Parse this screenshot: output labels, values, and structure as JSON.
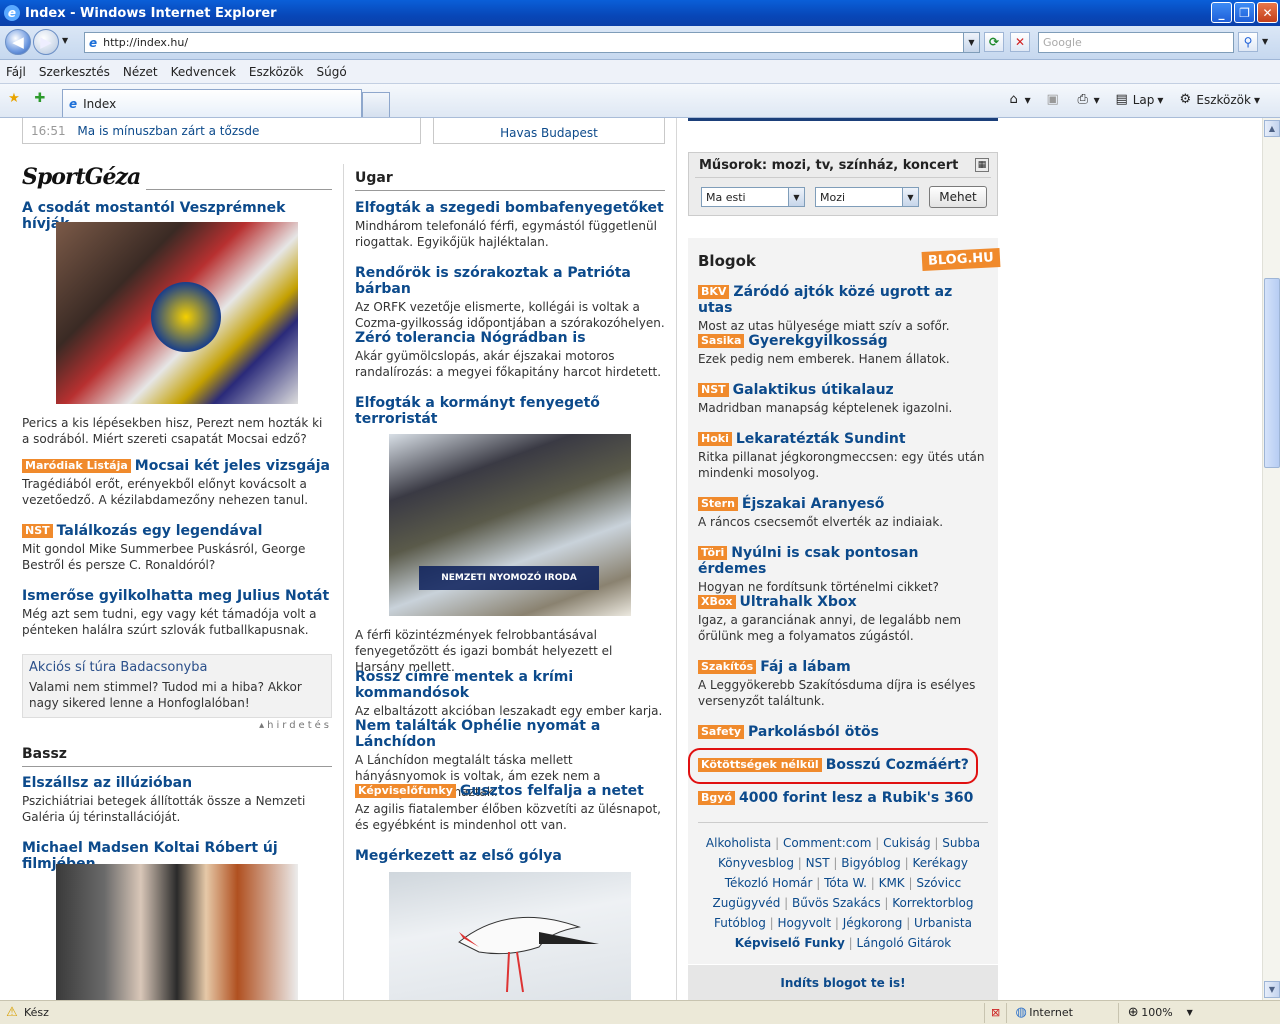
{
  "window": {
    "title": "Index - Windows Internet Explorer"
  },
  "address": {
    "url": "http://index.hu/",
    "search_placeholder": "Google"
  },
  "menu": [
    "Fájl",
    "Szerkesztés",
    "Nézet",
    "Kedvencek",
    "Eszközök",
    "Súgó"
  ],
  "tab": {
    "label": "Index"
  },
  "tools": {
    "page": "Lap",
    "tools": "Eszközök"
  },
  "status": {
    "text": "Kész",
    "zone": "Internet",
    "zoom": "100%"
  },
  "top": {
    "time": "16:51",
    "headline": "Ma is mínuszban zárt a tőzsde",
    "havas": "Havas Budapest"
  },
  "col1": {
    "logo": "SportGéza",
    "lead_title": "A csodát mostantól Veszprémnek hívják",
    "lead_desc": "Perics a kis lépésekben hisz, Perezt nem hozták ki a sodrából. Miért szereti csapatát Mocsai edző?",
    "items": [
      {
        "tag": "Maródiak Listája",
        "title": "Mocsai két jeles vizsgája",
        "desc": "Tragédiából erőt, erényekből előnyt kovácsolt a vezetőedző. A kézilabdamezőny nehezen tanul."
      },
      {
        "tag": "NST",
        "title": "Találkozás egy legendával",
        "desc": "Mit gondol Mike Summerbee Puskásról, George Bestről és persze C. Ronaldóról?"
      },
      {
        "tag": "",
        "title": "Ismerőse gyilkolhatta meg Julius Notát",
        "desc": "Még azt sem tudni, egy vagy két támadója volt a pénteken halálra szúrt szlovák futballkapusnak."
      }
    ],
    "ad_title": "Akciós sí túra Badacsonyba",
    "ad_text": "Valami nem stimmel? Tudod mi a hiba? Akkor nagy sikered lenne a Honfoglalóban!",
    "ad_label": "hirdetés",
    "section2": "Bassz",
    "items2": [
      {
        "title": "Elszállsz az illúzióban",
        "desc": "Pszichiátriai betegek állították össze a Nemzeti Galéria új térinstallációját."
      },
      {
        "title": "Michael Madsen Koltai Róbert új filmjében",
        "desc": ""
      }
    ]
  },
  "col2": {
    "section": "Ugar",
    "items": [
      {
        "tag": "",
        "title": "Elfogták a szegedi bombafenyegetőket",
        "desc": "Mindhárom telefonáló férfi, egymástól függetlenül riogattak. Egyikőjük hajléktalan."
      },
      {
        "tag": "",
        "title": "Rendőrök is szórakoztak a Patrióta bárban",
        "desc": "Az ORFK vezetője elismerte, kollégái is voltak a Cozma-gyilkosság időpontjában a szórakozóhelyen."
      },
      {
        "tag": "",
        "title": "Zéró tolerancia Nógrádban is",
        "desc": "Akár gyümölcslopás, akár éjszakai motoros randalírozás: a megyei főkapitány harcot hirdetett."
      },
      {
        "tag": "",
        "title": "Elfogták a kormányt fenyegető terroristát",
        "desc": ""
      }
    ],
    "photo_caption": "NEMZETI NYOMOZÓ IRODA",
    "photo_desc": "A férfi közintézmények felrobbantásával fenyegetőzött és igazi bombát helyezett el Harsány mellett.",
    "items2": [
      {
        "tag": "",
        "title": "Rossz címre mentek a krími kommandósok",
        "desc": "Az elbaltázott akcióban leszakadt egy ember karja."
      },
      {
        "tag": "",
        "title": "Nem találták Ophélie nyomát a Lánchídon",
        "desc": "A Lánchídon megtalált táska mellett hányásnyomok is voltak, ám ezek nem a diáklánytól származtak."
      },
      {
        "tag": "Képviselőfunky",
        "title": "Gusztos felfalja a netet",
        "desc": "Az agilis fiatalember élőben közvetíti az ülésnapot, és egyébként is mindenhol ott van."
      },
      {
        "tag": "",
        "title": "Megérkezett az első gólya",
        "desc": ""
      }
    ]
  },
  "right": {
    "musor_title": "Műsorok: mozi, tv, színház, koncert",
    "sel1": "Ma esti",
    "sel2": "Mozi",
    "go": "Mehet",
    "blog_title": "Blogok",
    "blog_logo": "BLOG.HU",
    "blogs": [
      {
        "tag": "BKV",
        "title": "Záródó ajtók közé ugrott az utas",
        "desc": "Most az utas hülyesége miatt szív a sofőr."
      },
      {
        "tag": "Sasika",
        "title": "Gyerekgyilkosság",
        "desc": "Ezek pedig nem emberek. Hanem állatok."
      },
      {
        "tag": "NST",
        "title": "Galaktikus útikalauz",
        "desc": "Madridban manapság képtelenek igazolni."
      },
      {
        "tag": "Hoki",
        "title": "Lekaratézták Sundint",
        "desc": "Ritka pillanat jégkorongmeccsen: egy ütés után mindenki mosolyog."
      },
      {
        "tag": "Stern",
        "title": "Éjszakai Aranyeső",
        "desc": "A ráncos csecsemőt elverték az indiaiak."
      },
      {
        "tag": "Töri",
        "title": "Nyúlni is csak pontosan érdemes",
        "desc": "Hogyan ne fordítsunk történelmi cikket?"
      },
      {
        "tag": "XBox",
        "title": "Ultrahalk Xbox",
        "desc": "Igaz, a garanciának annyi, de legalább nem őrülünk meg a folyamatos zúgástól."
      },
      {
        "tag": "Szakítós",
        "title": "Fáj a lábam",
        "desc": "A Leggyökerebb Szakítósduma díjra is esélyes versenyzőt találtunk."
      },
      {
        "tag": "Safety",
        "title": "Parkolásból ötös",
        "desc": ""
      },
      {
        "tag": "Kötöttségek nélkül",
        "title": "Bosszú Cozmáért?",
        "desc": ""
      },
      {
        "tag": "Bgyó",
        "title": "4000 forint lesz a Rubik's 360",
        "desc": ""
      }
    ],
    "blog_links": [
      [
        "Alkoholista",
        "Comment:com",
        "Cukiság",
        "Subba"
      ],
      [
        "Könyvesblog",
        "NST",
        "Bigyóblog",
        "Kerékagy"
      ],
      [
        "Tékozló Homár",
        "Tóta W.",
        "KMK",
        "Szóvicc"
      ],
      [
        "Zugügyvéd",
        "Bűvös Szakács",
        "Korrektorblog"
      ],
      [
        "Futóblog",
        "Hogyvolt",
        "Jégkorong",
        "Urbanista"
      ],
      [
        "Képviselő Funky",
        "Lángoló Gitárok"
      ]
    ],
    "start_blog": "Indíts blogot te is!"
  }
}
